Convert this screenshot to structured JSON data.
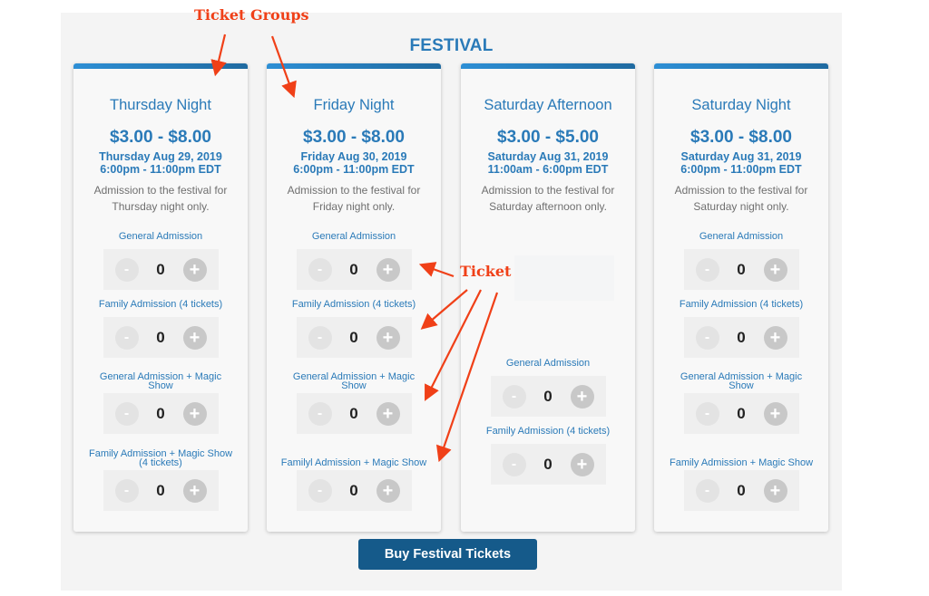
{
  "section": {
    "title": "FESTIVAL"
  },
  "ticket_groups": [
    {
      "title": "Thursday Night",
      "price": "$3.00 - $8.00",
      "date": "Thursday Aug 29, 2019",
      "time": "6:00pm - 11:00pm EDT",
      "description": "Admission to the festival for Thursday night only.",
      "tickets": [
        {
          "label": "General Admission",
          "quantity": "0"
        },
        {
          "label": "Family Admission (4 tickets)",
          "quantity": "0"
        },
        {
          "label": "General Admission + Magic Show",
          "quantity": "0"
        },
        {
          "label": "Family Admission + Magic Show (4 tickets)",
          "quantity": "0"
        }
      ]
    },
    {
      "title": "Friday Night",
      "price": "$3.00 - $8.00",
      "date": "Friday Aug 30, 2019",
      "time": "6:00pm - 11:00pm EDT",
      "description": "Admission to the festival for Friday night only.",
      "tickets": [
        {
          "label": "General Admission",
          "quantity": "0"
        },
        {
          "label": "Family Admission (4 tickets)",
          "quantity": "0"
        },
        {
          "label": "General Admission + Magic Show",
          "quantity": "0"
        },
        {
          "label": "Familyl Admission + Magic Show",
          "quantity": "0"
        }
      ]
    },
    {
      "title": "Saturday Afternoon",
      "price": "$3.00 - $5.00",
      "date": "Saturday Aug 31, 2019",
      "time": "11:00am - 6:00pm EDT",
      "description": "Admission to the festival for Saturday afternoon only.",
      "tickets": [
        {
          "label": "General Admission",
          "quantity": "0"
        },
        {
          "label": "Family Admission (4 tickets)",
          "quantity": "0"
        }
      ]
    },
    {
      "title": "Saturday Night",
      "price": "$3.00 - $8.00",
      "date": "Saturday Aug 31, 2019",
      "time": "6:00pm - 11:00pm EDT",
      "description": "Admission to the festival for Saturday night only.",
      "tickets": [
        {
          "label": "General Admission",
          "quantity": "0"
        },
        {
          "label": "Family Admission (4 tickets)",
          "quantity": "0"
        },
        {
          "label": "General Admission + Magic Show",
          "quantity": "0"
        },
        {
          "label": "Family Admission + Magic Show",
          "quantity": "0"
        }
      ]
    }
  ],
  "stepper": {
    "minus_symbol": "-",
    "plus_symbol": "+"
  },
  "buy_button": {
    "label": "Buy Festival Tickets"
  },
  "annotations": {
    "ticket_groups_label": "Ticket Groups",
    "ticket_label": "Ticket",
    "color": "#f04018"
  },
  "colors": {
    "accent": "#2a7ab8",
    "button": "#155a8a",
    "card_bar_start": "#2d8fd5",
    "card_bar_end": "#1f6aa0"
  }
}
